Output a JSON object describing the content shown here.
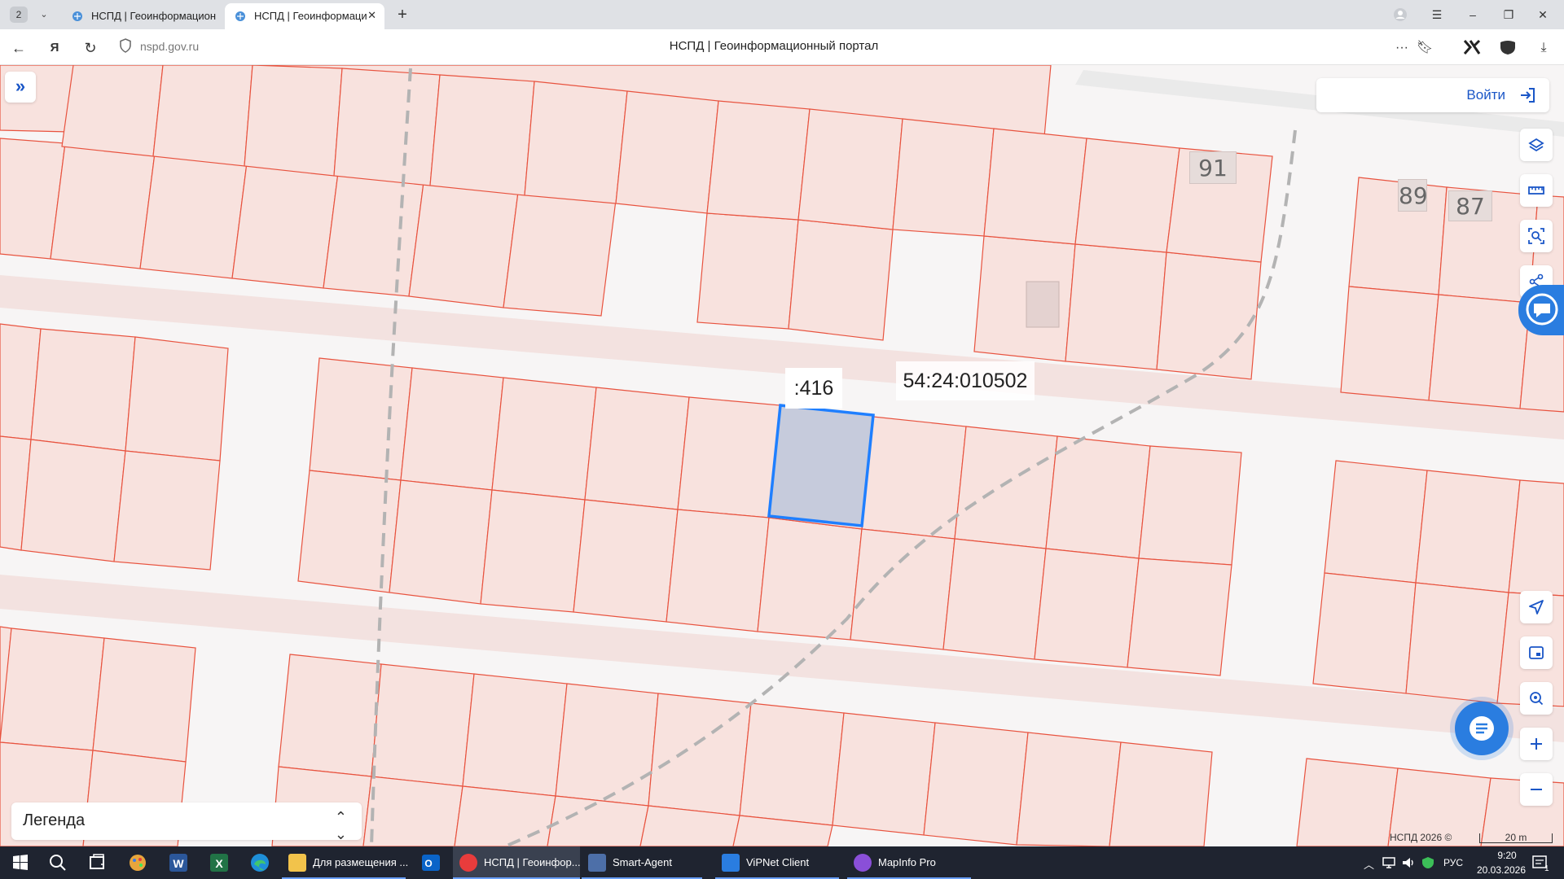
{
  "browser": {
    "tab_count": "2",
    "tabs": [
      {
        "title": "НСПД | Геоинформацион"
      },
      {
        "title": "НСПД | Геоинформаци"
      }
    ],
    "url": "nspd.gov.ru",
    "page_title": "НСПД | Геоинформационный портал"
  },
  "map": {
    "selected_parcel_label": ":416",
    "cadastral_block_label": "54:24:010502",
    "house_numbers": [
      "91",
      "89",
      "87"
    ],
    "login_label": "Войти",
    "legend_label": "Легенда",
    "copyright": "НСПД 2026 ©",
    "scale_label": "20 m",
    "colors": {
      "parcel_fill": "#f8e2de",
      "parcel_line": "#e8533f",
      "selected_fill": "#c6cbdc",
      "selected_line": "#1f7fff",
      "accent": "#2a7de0"
    }
  },
  "taskbar": {
    "apps": [
      {
        "label": "Для размещения ...",
        "icon": "folder-icon"
      },
      {
        "label": "НСПД | Геоинфор...",
        "icon": "yandex-browser-icon"
      },
      {
        "label": "Smart-Agent",
        "icon": "smart-agent-icon"
      },
      {
        "label": "ViPNet Client",
        "icon": "vipnet-icon"
      },
      {
        "label": "MapInfo Pro",
        "icon": "mapinfo-icon"
      }
    ],
    "language": "РУС",
    "time": "9:20",
    "date": "20.03.2026",
    "notifications": "1"
  }
}
